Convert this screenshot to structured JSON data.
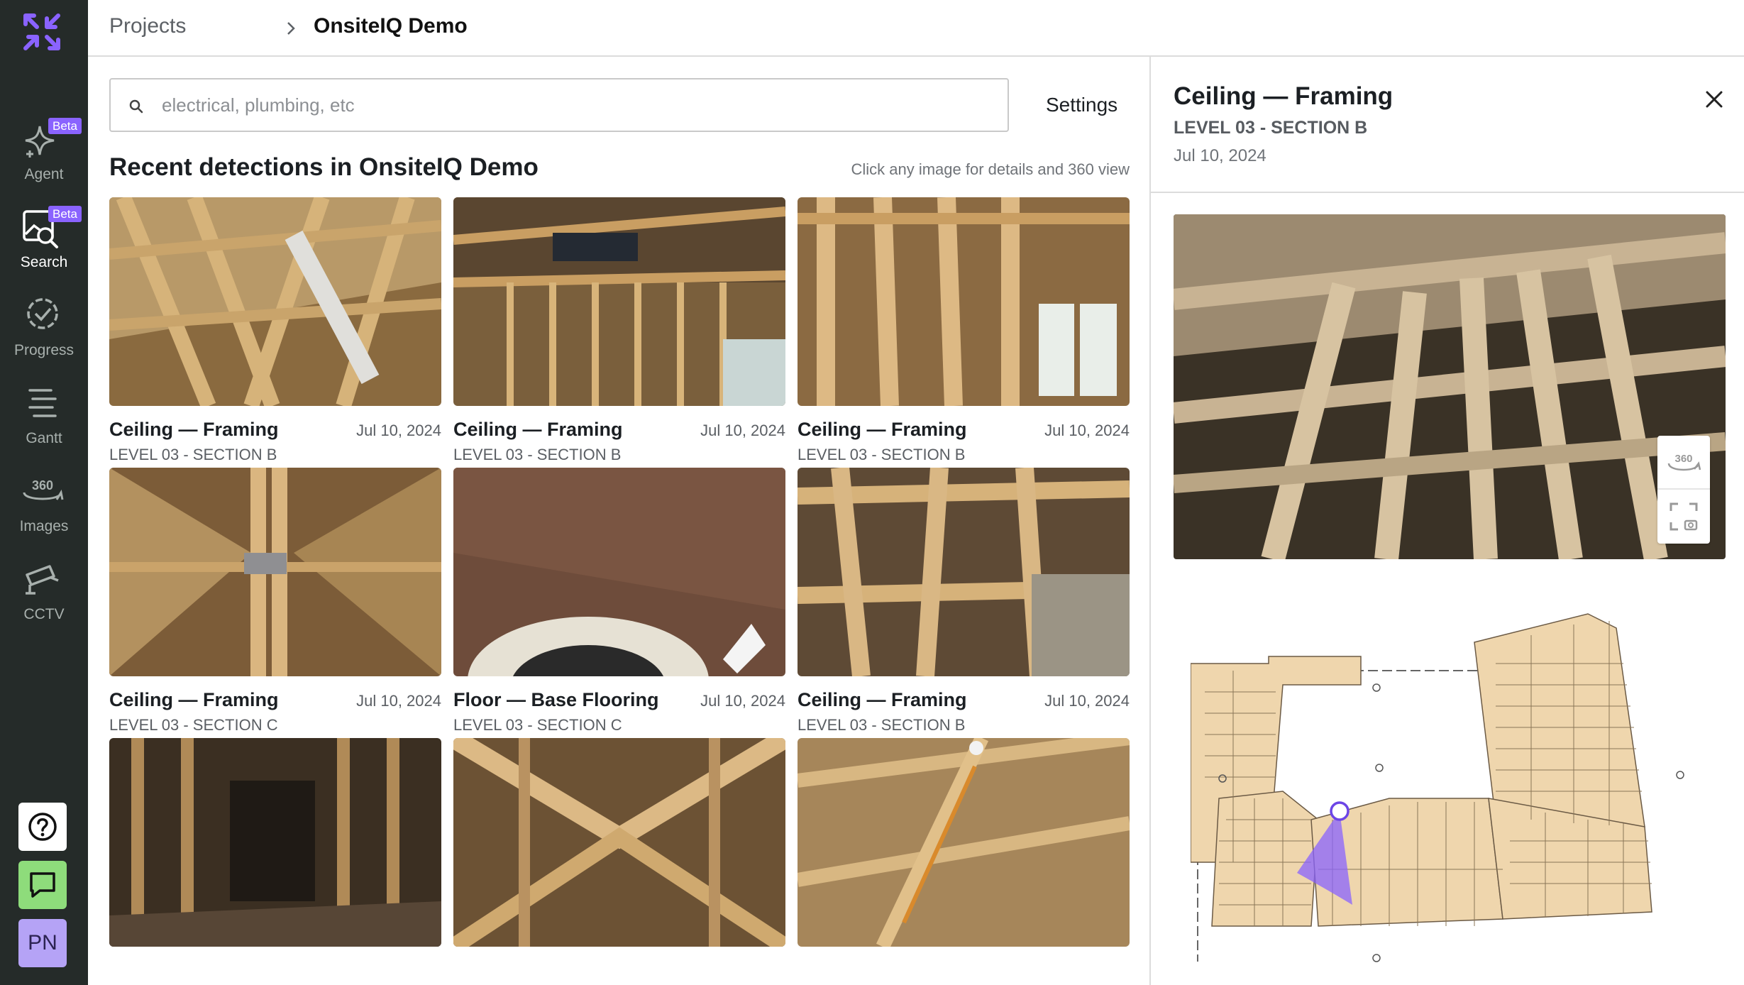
{
  "app": {
    "brand_color": "#8a63ff",
    "rail_color": "#252b29"
  },
  "nav": {
    "beta_label": "Beta",
    "items": [
      {
        "label": "Agent",
        "icon": "sparkle-icon",
        "beta": true
      },
      {
        "label": "Search",
        "icon": "image-search-icon",
        "beta": true,
        "active": true
      },
      {
        "label": "Progress",
        "icon": "check-circle-icon"
      },
      {
        "label": "Gantt",
        "icon": "gantt-lines-icon"
      },
      {
        "label": "Images",
        "icon": "360-icon"
      },
      {
        "label": "CCTV",
        "icon": "camera-icon"
      }
    ],
    "help_icon": "question-circle-icon",
    "chat_icon": "chat-bubble-icon",
    "avatar_initials": "PN"
  },
  "breadcrumb": {
    "parent": "Projects",
    "current": "OnsiteIQ Demo"
  },
  "search": {
    "placeholder": "electrical, plumbing, etc",
    "value": "",
    "settings_label": "Settings"
  },
  "results": {
    "title": "Recent detections in OnsiteIQ Demo",
    "hint": "Click any image for details and 360 view",
    "cards": [
      {
        "title": "Ceiling — Framing",
        "date": "Jul 10, 2024",
        "location": "LEVEL 03 - SECTION B"
      },
      {
        "title": "Ceiling — Framing",
        "date": "Jul 10, 2024",
        "location": "LEVEL 03 - SECTION B"
      },
      {
        "title": "Ceiling — Framing",
        "date": "Jul 10, 2024",
        "location": "LEVEL 03 - SECTION B"
      },
      {
        "title": "Ceiling — Framing",
        "date": "Jul 10, 2024",
        "location": "LEVEL 03 - SECTION C"
      },
      {
        "title": "Floor — Base Flooring",
        "date": "Jul 10, 2024",
        "location": "LEVEL 03 - SECTION C"
      },
      {
        "title": "Ceiling — Framing",
        "date": "Jul 10, 2024",
        "location": "LEVEL 03 - SECTION B"
      },
      {
        "title": "",
        "date": "",
        "location": ""
      },
      {
        "title": "",
        "date": "",
        "location": ""
      },
      {
        "title": "",
        "date": "",
        "location": ""
      }
    ]
  },
  "detail": {
    "title": "Ceiling — Framing",
    "location": "LEVEL 03 - SECTION B",
    "date": "Jul 10, 2024",
    "tool_360_label": "360",
    "tool_360_icon": "360-view-icon",
    "tool_capture_icon": "screenshot-frame-icon",
    "close_icon": "close-icon"
  }
}
